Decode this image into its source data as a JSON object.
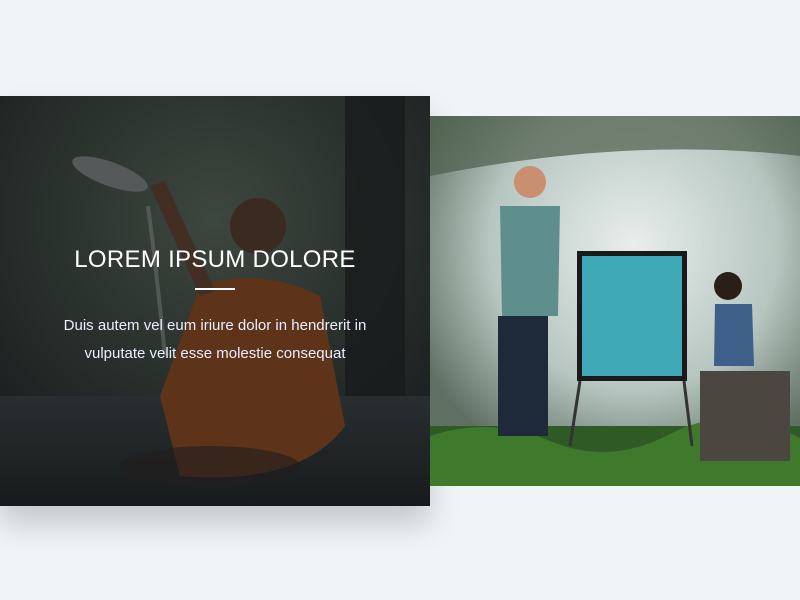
{
  "hero": {
    "title": "LOREM IPSUM DOLORE",
    "description": "Duis autem vel eum iriure dolor in hendrerit in vulputate velit esse molestie consequat"
  },
  "images": {
    "left": "monk-splashing-water-photo",
    "right": "teacher-and-child-with-chart-photo"
  },
  "colors": {
    "page_background": "#f0f4f7",
    "overlay": "rgba(20,24,28,0.45)",
    "text": "#ffffff"
  }
}
